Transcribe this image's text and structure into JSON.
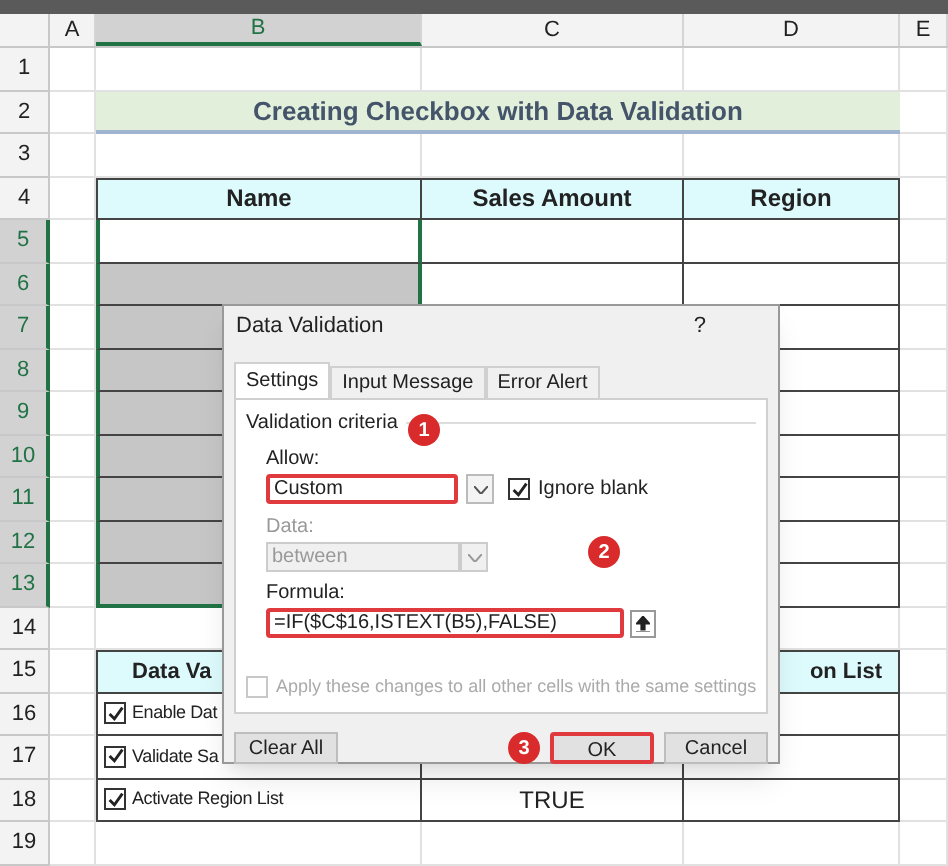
{
  "sheet": {
    "columns": [
      {
        "label": "A",
        "selected": false
      },
      {
        "label": "B",
        "selected": true
      },
      {
        "label": "C",
        "selected": false
      },
      {
        "label": "D",
        "selected": false
      },
      {
        "label": "E",
        "selected": false
      }
    ],
    "rows": [
      {
        "label": "1",
        "selected": false
      },
      {
        "label": "2",
        "selected": false
      },
      {
        "label": "3",
        "selected": false
      },
      {
        "label": "4",
        "selected": false
      },
      {
        "label": "5",
        "selected": true
      },
      {
        "label": "6",
        "selected": true
      },
      {
        "label": "7",
        "selected": true
      },
      {
        "label": "8",
        "selected": true
      },
      {
        "label": "9",
        "selected": true
      },
      {
        "label": "10",
        "selected": true
      },
      {
        "label": "11",
        "selected": true
      },
      {
        "label": "12",
        "selected": true
      },
      {
        "label": "13",
        "selected": true
      },
      {
        "label": "14",
        "selected": false
      },
      {
        "label": "15",
        "selected": false
      },
      {
        "label": "16",
        "selected": false
      },
      {
        "label": "17",
        "selected": false
      },
      {
        "label": "18",
        "selected": false
      },
      {
        "label": "19",
        "selected": false
      }
    ],
    "title": "Creating Checkbox with Data Validation",
    "table_headers": [
      "Name",
      "Sales Amount",
      "Region"
    ],
    "lower_headers": [
      "Data Va",
      "on List"
    ],
    "checkbox_rows": [
      {
        "label": "Enable Dat",
        "checked": true
      },
      {
        "label": "Validate Sa",
        "checked": true
      },
      {
        "label": "Activate Region List",
        "checked": true,
        "value": "TRUE"
      }
    ]
  },
  "dialog": {
    "title": "Data Validation",
    "help": "?",
    "tabs": [
      {
        "label": "Settings",
        "selected": true
      },
      {
        "label": "Input Message",
        "selected": false
      },
      {
        "label": "Error Alert",
        "selected": false
      }
    ],
    "group": "Validation criteria",
    "allow": {
      "label": "Allow:",
      "value": "Custom",
      "marker": "1"
    },
    "ignore_blank": {
      "label": "Ignore blank",
      "checked": true
    },
    "data": {
      "label": "Data:",
      "value": "between",
      "disabled": true
    },
    "formula": {
      "label": "Formula:",
      "value": "=IF($C$16,ISTEXT(B5),FALSE)",
      "marker": "2"
    },
    "apply": {
      "label": "Apply these changes to all other cells with the same settings",
      "checked": false,
      "disabled": true
    },
    "buttons": [
      {
        "label": "Clear All",
        "highlighted": false
      },
      {
        "label": "OK",
        "highlighted": true,
        "marker": "3"
      },
      {
        "label": "Cancel",
        "highlighted": false
      }
    ]
  }
}
